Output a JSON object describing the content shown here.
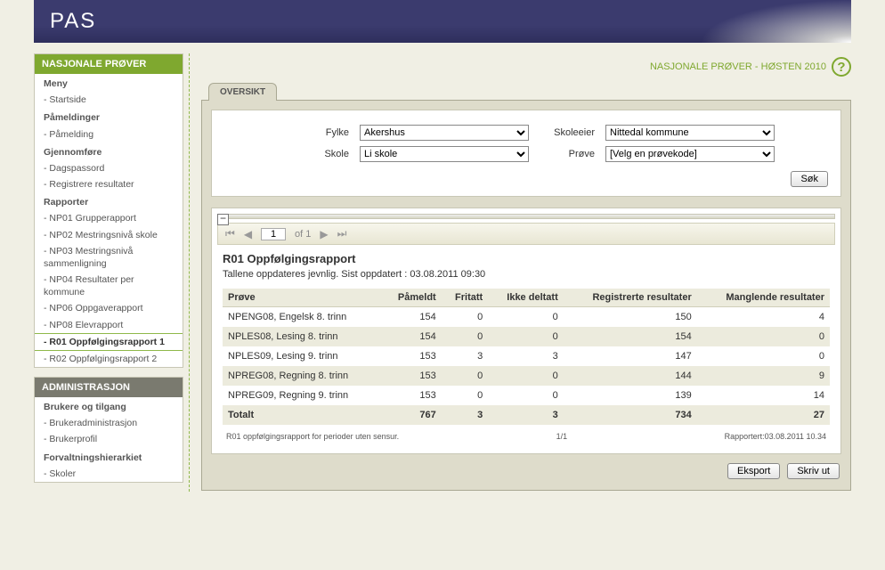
{
  "header": {
    "title": "PAS"
  },
  "topline": {
    "text": "NASJONALE PRØVER - HØSTEN 2010"
  },
  "sidebar": {
    "block1_title": "NASJONALE PRØVER",
    "block2_title": "ADMINISTRASJON",
    "items1": [
      {
        "label": "Meny",
        "group": true
      },
      {
        "label": "- Startside"
      },
      {
        "label": "Påmeldinger",
        "group": true
      },
      {
        "label": "- Påmelding"
      },
      {
        "label": "Gjennomføre",
        "group": true
      },
      {
        "label": "- Dagspassord"
      },
      {
        "label": "- Registrere resultater"
      },
      {
        "label": "Rapporter",
        "group": true
      },
      {
        "label": "- NP01 Grupperapport"
      },
      {
        "label": "- NP02 Mestringsnivå skole"
      },
      {
        "label": "- NP03 Mestringsnivå sammenligning"
      },
      {
        "label": "- NP04 Resultater per kommune"
      },
      {
        "label": "- NP06 Oppgaverapport"
      },
      {
        "label": "- NP08 Elevrapport"
      },
      {
        "label": "- R01 Oppfølgingsrapport 1",
        "active": true
      },
      {
        "label": "- R02 Oppfølgingsrapport 2"
      }
    ],
    "items2": [
      {
        "label": "Brukere og tilgang",
        "group": true
      },
      {
        "label": "- Brukeradministrasjon"
      },
      {
        "label": "- Brukerprofil"
      },
      {
        "label": "Forvaltningshierarkiet",
        "group": true
      },
      {
        "label": "- Skoler"
      }
    ]
  },
  "tabs": {
    "oversikt": "OVERSIKT"
  },
  "filters": {
    "fylke_label": "Fylke",
    "fylke_value": "Akershus",
    "skoleeier_label": "Skoleeier",
    "skoleeier_value": "Nittedal kommune",
    "skole_label": "Skole",
    "skole_value": "Li skole",
    "prove_label": "Prøve",
    "prove_value": "[Velg en prøvekode]",
    "sok": "Søk"
  },
  "pager": {
    "page": "1",
    "of": "of 1"
  },
  "report": {
    "title": "R01 Oppfølgingsrapport",
    "subtitle": "Tallene oppdateres jevnlig. Sist oppdatert : 03.08.2011 09:30",
    "columns": {
      "c0": "Prøve",
      "c1": "Påmeldt",
      "c2": "Fritatt",
      "c3": "Ikke deltatt",
      "c4": "Registrerte resultater",
      "c5": "Manglende resultater"
    },
    "rows": [
      {
        "c0": "NPENG08, Engelsk 8. trinn",
        "c1": "154",
        "c2": "0",
        "c3": "0",
        "c4": "150",
        "c5": "4"
      },
      {
        "c0": "NPLES08, Lesing 8. trinn",
        "c1": "154",
        "c2": "0",
        "c3": "0",
        "c4": "154",
        "c5": "0"
      },
      {
        "c0": "NPLES09, Lesing 9. trinn",
        "c1": "153",
        "c2": "3",
        "c3": "3",
        "c4": "147",
        "c5": "0"
      },
      {
        "c0": "NPREG08, Regning 8. trinn",
        "c1": "153",
        "c2": "0",
        "c3": "0",
        "c4": "144",
        "c5": "9"
      },
      {
        "c0": "NPREG09, Regning 9. trinn",
        "c1": "153",
        "c2": "0",
        "c3": "0",
        "c4": "139",
        "c5": "14"
      }
    ],
    "total": {
      "c0": "Totalt",
      "c1": "767",
      "c2": "3",
      "c3": "3",
      "c4": "734",
      "c5": "27"
    },
    "footer_left": "R01 oppfølgingsrapport for perioder uten sensur.",
    "footer_mid": "1/1",
    "footer_right": "Rapportert:03.08.2011 10.34"
  },
  "buttons": {
    "eksport": "Eksport",
    "skrivut": "Skriv ut"
  }
}
